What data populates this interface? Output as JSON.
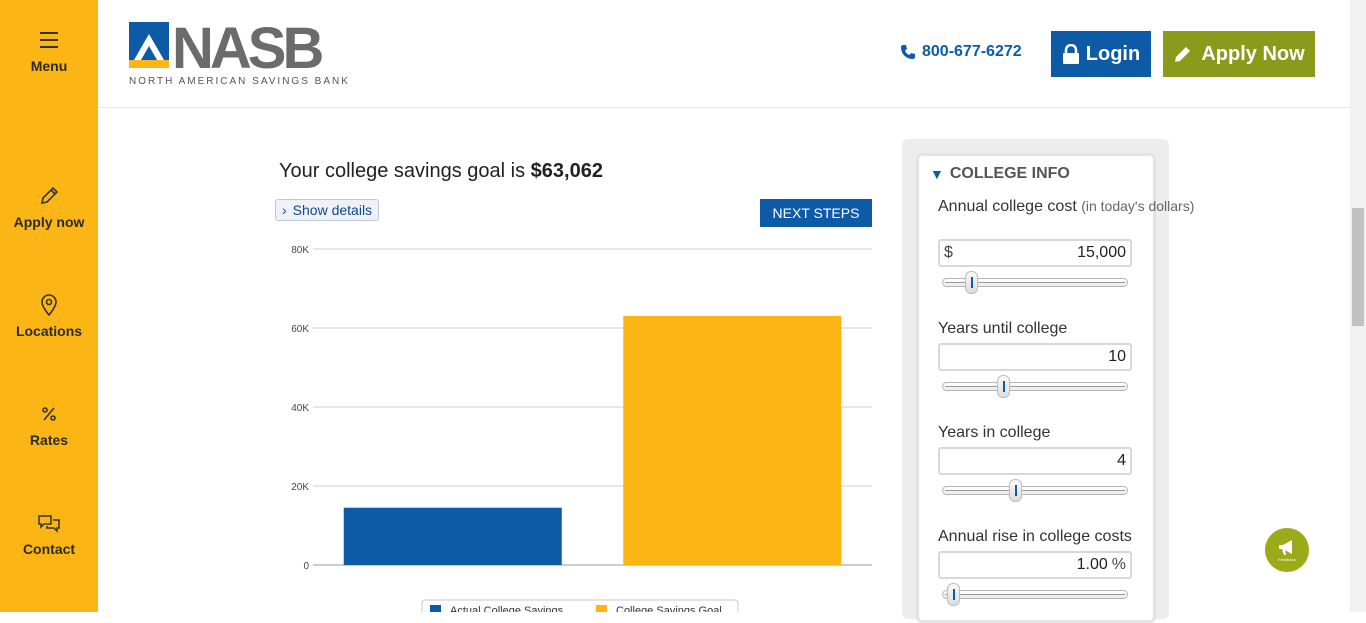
{
  "sidebar": {
    "items": [
      {
        "label": "Menu",
        "icon": "hamburger-icon"
      },
      {
        "label": "Apply now",
        "icon": "pencil-icon"
      },
      {
        "label": "Locations",
        "icon": "map-pin-icon"
      },
      {
        "label": "Rates",
        "icon": "percent-icon"
      },
      {
        "label": "Contact",
        "icon": "chat-bubbles-icon"
      }
    ]
  },
  "header": {
    "logo_text": "NASB",
    "logo_tagline": "NORTH AMERICAN SAVINGS BANK",
    "phone": "800-677-6272",
    "login_label": "Login",
    "apply_label": "Apply Now"
  },
  "main": {
    "goal_prefix": "Your college savings goal is",
    "goal_amount": "$63,062",
    "show_details_label": "Show details",
    "next_steps_label": "NEXT STEPS"
  },
  "panel": {
    "heading": "COLLEGE INFO",
    "fields": [
      {
        "label": "Annual college cost",
        "sublabel": "(in today's dollars)",
        "prefix": "$",
        "value": "15,000",
        "suffix": "",
        "slider_fraction": 0.14
      },
      {
        "label": "Years until college",
        "value": "10",
        "prefix": "",
        "suffix": "",
        "slider_fraction": 0.32
      },
      {
        "label": "Years in college",
        "value": "4",
        "prefix": "",
        "suffix": "",
        "slider_fraction": 0.39
      },
      {
        "label": "Annual rise in college costs",
        "value": "1.00",
        "prefix": "",
        "suffix": "%",
        "slider_fraction": 0.04
      }
    ]
  },
  "feedback_label": "Feedback",
  "colors": {
    "sidebar": "#fbb615",
    "brand_blue": "#0d5aa7",
    "apply_green": "#8a9a1a",
    "goal_bar": "#fbb615"
  },
  "chart_data": {
    "type": "bar",
    "categories": [
      "Actual College Savings",
      "College Savings Goal"
    ],
    "values": [
      14500,
      63062
    ],
    "colors": [
      "#0d5aa7",
      "#fbb615"
    ],
    "yticks": [
      "0",
      "20K",
      "40K",
      "60K",
      "80K"
    ],
    "ytick_values": [
      0,
      20000,
      40000,
      60000,
      80000
    ],
    "ylim": [
      0,
      80000
    ],
    "legend": [
      "Actual College Savings",
      "College Savings Goal"
    ],
    "legend_position": "bottom",
    "grid": true
  }
}
